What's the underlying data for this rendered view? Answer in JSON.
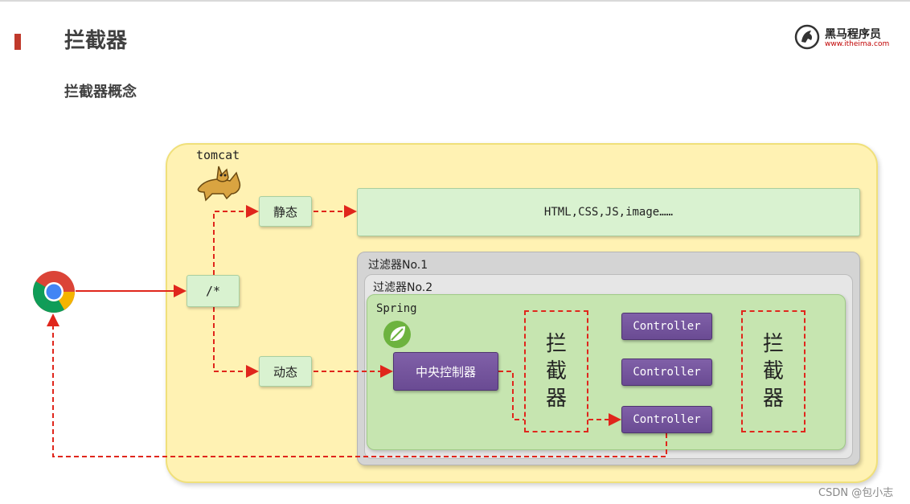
{
  "slide": {
    "title": "拦截器",
    "subtitle": "拦截器概念",
    "accent_color": "#c0392b"
  },
  "logo": {
    "name": "黑马程序员",
    "url": "www.itheima.com"
  },
  "diagram": {
    "container_label": "tomcat",
    "entry_label": "/*",
    "static_label": "静态",
    "dynamic_label": "动态",
    "static_resources": "HTML,CSS,JS,image……",
    "filter_1": "过滤器No.1",
    "filter_2": "过滤器No.2",
    "framework_label": "Spring",
    "dispatcher_label": "中央控制器",
    "interceptor_chars": [
      "拦",
      "截",
      "器"
    ],
    "controllers": [
      "Controller",
      "Controller",
      "Controller"
    ],
    "icons": [
      "chrome-browser-icon",
      "tomcat-cat-icon",
      "spring-leaf-icon"
    ],
    "colors": {
      "flow_line": "#e0261c",
      "tomcat_bg": "#fff2b3",
      "spring_bg": "#c6e5b0",
      "controller_bg": "#7555a0"
    }
  },
  "watermark": "CSDN @包小志"
}
